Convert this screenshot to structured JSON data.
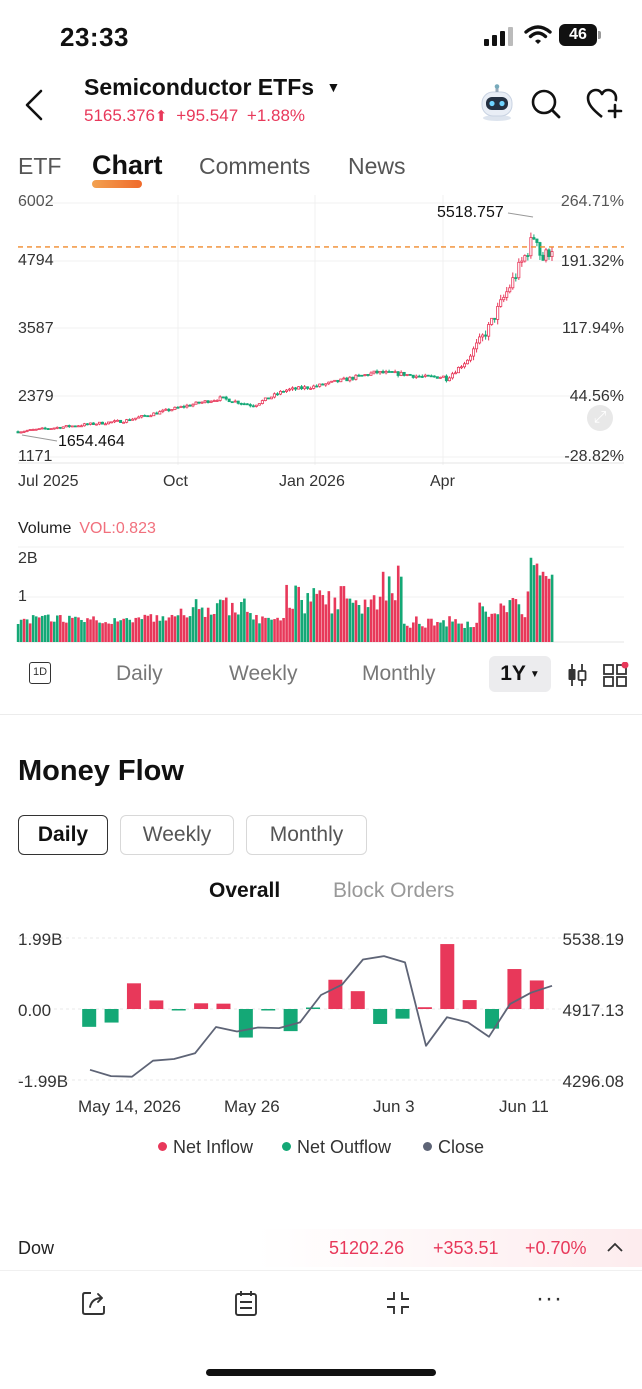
{
  "status": {
    "time": "23:33",
    "battery": "46"
  },
  "header": {
    "title": "Semiconductor ETFs",
    "price": "5165.376",
    "change": "+95.547",
    "pct": "+1.88%"
  },
  "tabs": [
    "ETF",
    "Chart",
    "Comments",
    "News"
  ],
  "active_tab": "Chart",
  "price_chart": {
    "left_axis": [
      "6002",
      "4794",
      "3587",
      "2379",
      "1171"
    ],
    "right_axis": [
      "264.71%",
      "191.32%",
      "117.94%",
      "44.56%",
      "-28.82%"
    ],
    "x_labels": [
      "Jul 2025",
      "Oct",
      "Jan 2026",
      "Apr"
    ],
    "high_label": "5518.757",
    "low_label": "1654.464",
    "current_price": 5165.376,
    "ylim": [
      1171,
      6002
    ]
  },
  "volume": {
    "label": "Volume",
    "vol_text": "VOL:0.823",
    "axis": [
      "2B",
      "1"
    ]
  },
  "periods": {
    "intraday": "1D",
    "items": [
      "Daily",
      "Weekly",
      "Monthly"
    ],
    "selected": "1Y"
  },
  "money_flow": {
    "title": "Money Flow",
    "segments": [
      "Daily",
      "Weekly",
      "Monthly"
    ],
    "active_segment": "Daily",
    "subtabs": [
      "Overall",
      "Block Orders"
    ],
    "active_subtab": "Overall",
    "legend": [
      "Net Inflow",
      "Net Outflow",
      "Close"
    ]
  },
  "chart_data": {
    "type": "bar",
    "left_ticks": [
      "1.99B",
      "0.00",
      "-1.99B"
    ],
    "right_ticks": [
      "5538.19",
      "4917.13",
      "4296.08"
    ],
    "x_labels": [
      "May 14, 2026",
      "May 26",
      "Jun 3",
      "Jun 11"
    ],
    "ylim": [
      -1.99,
      1.99
    ],
    "y2lim": [
      4296.08,
      5538.19
    ],
    "series": [
      {
        "name": "Net Inflow",
        "color": "#e8385a",
        "values": [
          0,
          0,
          0.72,
          0.24,
          0,
          0.16,
          0.15,
          0,
          0,
          0,
          0,
          0.82,
          0.5,
          0,
          0,
          0.05,
          1.82,
          0.25,
          0,
          1.12,
          0.8
        ]
      },
      {
        "name": "Net Outflow",
        "color": "#14a876",
        "values": [
          -0.5,
          -0.38,
          0,
          0,
          -0.04,
          0,
          0,
          -0.8,
          -0.03,
          -0.62,
          0,
          0,
          0,
          -0.42,
          -0.27,
          0,
          0,
          0,
          -0.55,
          0,
          0
        ]
      },
      {
        "name": "Close",
        "color": "#5e6476",
        "values": [
          4385,
          4330,
          4325,
          4465,
          4480,
          4530,
          4760,
          4720,
          4755,
          4750,
          4800,
          5040,
          5130,
          5350,
          5380,
          5325,
          4595,
          4845,
          4800,
          4675,
          4960,
          5060,
          5120
        ]
      }
    ]
  },
  "ticker": {
    "name": "Dow",
    "value": "51202.26",
    "change": "+353.51",
    "pct": "+0.70%"
  }
}
